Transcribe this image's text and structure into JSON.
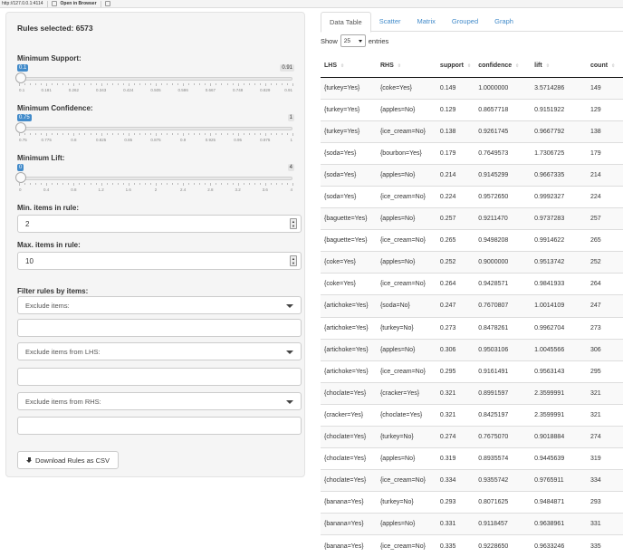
{
  "browser": {
    "url": "http://127.0.0.1:4114",
    "open_in_browser": "Open in Browser"
  },
  "sidebar": {
    "rules_selected": "Rules selected: 6573",
    "min_support": {
      "label": "Minimum Support:",
      "value": 0.1,
      "min_label": "0.1",
      "max_label": "0.91",
      "ticks": [
        "0.1",
        "0.181",
        "0.262",
        "0.343",
        "0.424",
        "0.505",
        "0.586",
        "0.667",
        "0.748",
        "0.829",
        "0.91"
      ]
    },
    "min_confidence": {
      "label": "Minimum Confidence:",
      "value": 0.75,
      "min_label": "0.75",
      "max_label": "1",
      "ticks": [
        "0.75",
        "0.775",
        "0.8",
        "0.825",
        "0.85",
        "0.875",
        "0.9",
        "0.925",
        "0.95",
        "0.975",
        "1"
      ]
    },
    "min_lift": {
      "label": "Minimum Lift:",
      "value": 0,
      "min_label": "0",
      "max_label": "4",
      "ticks": [
        "0",
        "0.4",
        "0.8",
        "1.2",
        "1.6",
        "2",
        "2.4",
        "2.8",
        "3.2",
        "3.6",
        "4"
      ]
    },
    "min_items": {
      "label": "Min. items in rule:",
      "value": "2"
    },
    "max_items": {
      "label": "Max. items in rule:",
      "value": "10"
    },
    "filter_label": "Filter rules by items:",
    "exclude_items": "Exclude items:",
    "exclude_lhs": "Exclude items from LHS:",
    "exclude_rhs": "Exclude items from RHS:",
    "download_label": "Download Rules as CSV"
  },
  "tabs": [
    "Data Table",
    "Scatter",
    "Matrix",
    "Grouped",
    "Graph"
  ],
  "show_entries": {
    "prefix": "Show",
    "value": "25",
    "suffix": "entries"
  },
  "table": {
    "headers": [
      "LHS",
      "RHS",
      "support",
      "confidence",
      "lift",
      "count"
    ],
    "rows": [
      [
        "{turkey=Yes}",
        "{coke=Yes}",
        "0.149",
        "1.0000000",
        "3.5714286",
        "149"
      ],
      [
        "{turkey=Yes}",
        "{apples=No}",
        "0.129",
        "0.8657718",
        "0.9151922",
        "129"
      ],
      [
        "{turkey=Yes}",
        "{ice_cream=No}",
        "0.138",
        "0.9261745",
        "0.9667792",
        "138"
      ],
      [
        "{soda=Yes}",
        "{bourbon=Yes}",
        "0.179",
        "0.7649573",
        "1.7306725",
        "179"
      ],
      [
        "{soda=Yes}",
        "{apples=No}",
        "0.214",
        "0.9145299",
        "0.9667335",
        "214"
      ],
      [
        "{soda=Yes}",
        "{ice_cream=No}",
        "0.224",
        "0.9572650",
        "0.9992327",
        "224"
      ],
      [
        "{baguette=Yes}",
        "{apples=No}",
        "0.257",
        "0.9211470",
        "0.9737283",
        "257"
      ],
      [
        "{baguette=Yes}",
        "{ice_cream=No}",
        "0.265",
        "0.9498208",
        "0.9914622",
        "265"
      ],
      [
        "{coke=Yes}",
        "{apples=No}",
        "0.252",
        "0.9000000",
        "0.9513742",
        "252"
      ],
      [
        "{coke=Yes}",
        "{ice_cream=No}",
        "0.264",
        "0.9428571",
        "0.9841933",
        "264"
      ],
      [
        "{artichoke=Yes}",
        "{soda=No}",
        "0.247",
        "0.7670807",
        "1.0014109",
        "247"
      ],
      [
        "{artichoke=Yes}",
        "{turkey=No}",
        "0.273",
        "0.8478261",
        "0.9962704",
        "273"
      ],
      [
        "{artichoke=Yes}",
        "{apples=No}",
        "0.306",
        "0.9503106",
        "1.0045566",
        "306"
      ],
      [
        "{artichoke=Yes}",
        "{ice_cream=No}",
        "0.295",
        "0.9161491",
        "0.9563143",
        "295"
      ],
      [
        "{choclate=Yes}",
        "{cracker=Yes}",
        "0.321",
        "0.8991597",
        "2.3599991",
        "321"
      ],
      [
        "{cracker=Yes}",
        "{choclate=Yes}",
        "0.321",
        "0.8425197",
        "2.3599991",
        "321"
      ],
      [
        "{choclate=Yes}",
        "{turkey=No}",
        "0.274",
        "0.7675070",
        "0.9018884",
        "274"
      ],
      [
        "{choclate=Yes}",
        "{apples=No}",
        "0.319",
        "0.8935574",
        "0.9445639",
        "319"
      ],
      [
        "{choclate=Yes}",
        "{ice_cream=No}",
        "0.334",
        "0.9355742",
        "0.9765911",
        "334"
      ],
      [
        "{banana=Yes}",
        "{turkey=No}",
        "0.293",
        "0.8071625",
        "0.9484871",
        "293"
      ],
      [
        "{banana=Yes}",
        "{apples=No}",
        "0.331",
        "0.9118457",
        "0.9638961",
        "331"
      ],
      [
        "{banana=Yes}",
        "{ice_cream=No}",
        "0.335",
        "0.9228650",
        "0.9633246",
        "335"
      ]
    ]
  }
}
